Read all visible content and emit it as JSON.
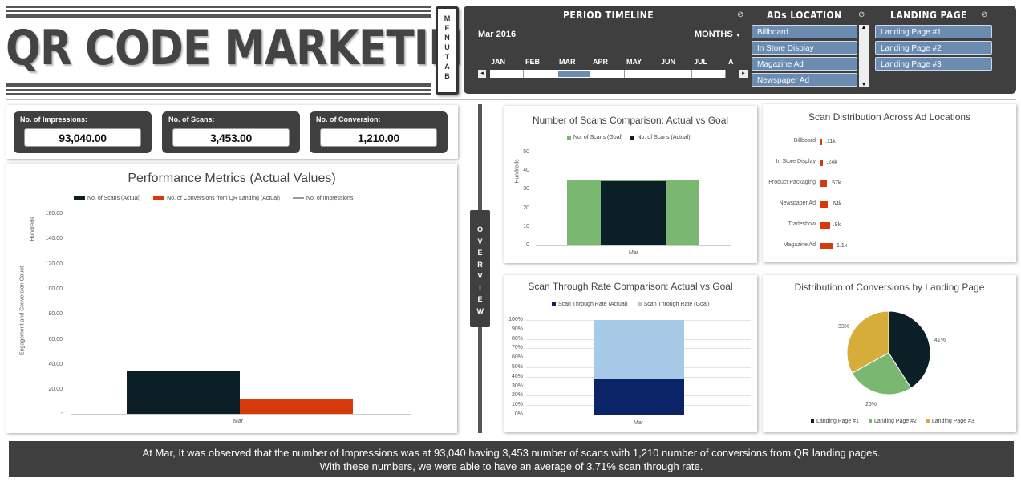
{
  "header": {
    "title": "QR CODE MARKETING",
    "menu_tab": "MENU TAB"
  },
  "timeline": {
    "title": "PERIOD TIMELINE",
    "selected_period": "Mar 2016",
    "granularity": "MONTHS",
    "months": [
      "JAN",
      "FEB",
      "MAR",
      "APR",
      "MAY",
      "JUN",
      "JUL",
      "A"
    ],
    "selected_month": "MAR"
  },
  "ad_locations": {
    "title": "ADs LOCATION",
    "items": [
      "Billboard",
      "In Store Display",
      "Magazine Ad",
      "Newspaper Ad"
    ]
  },
  "landing_pages": {
    "title": "LANDING PAGE",
    "items": [
      "Landing Page #1",
      "Landing Page #2",
      "Landing Page #3"
    ]
  },
  "kpis": [
    {
      "label": "No. of Impressions:",
      "value": "93,040.00"
    },
    {
      "label": "No. of Scans:",
      "value": "3,453.00"
    },
    {
      "label": "No. of Conversion:",
      "value": "1,210.00"
    }
  ],
  "overview_tab": "OVERVIEW",
  "colors": {
    "dark": "#3f3f3f",
    "navy": "#0b1f26",
    "orange": "#d63a0a",
    "green": "#7ab872",
    "slicer": "#6b8cb0",
    "gold": "#d6ac3a",
    "darkblue": "#0b2468",
    "lightblue": "#a6c9e8"
  },
  "summary": {
    "line1": "At Mar, It was observed that the number of Impressions was at 93,040 having 3,453 number of scans with 1,210 number of conversions from QR landing pages.",
    "line2": "With these numbers, we were able to have an average of 3.71% scan through rate."
  },
  "chart_data": [
    {
      "type": "bar",
      "title": "Performance Metrics (Actual Values)",
      "ylabel": "Engagement and Conversion Count",
      "units_label": "Hundreds",
      "categories": [
        "Mar"
      ],
      "yticks": [
        "160.00",
        "140.00",
        "120.00",
        "100.00",
        "80.00",
        "60.00",
        "40.00",
        "20.00",
        "-"
      ],
      "ylim": [
        0,
        160
      ],
      "series": [
        {
          "name": "No. of Scans (Actual)",
          "values": [
            34.53
          ]
        },
        {
          "name": "No. of Conversions from QR Landing (Actual)",
          "values": [
            12.1
          ]
        },
        {
          "name": "No. of Impressions",
          "values": [
            930.4
          ]
        }
      ]
    },
    {
      "type": "bar",
      "title": "Number of Scans Comparison: Actual vs Goal",
      "units_label": "Hundreds",
      "categories": [
        "Mar"
      ],
      "yticks": [
        "50",
        "40",
        "30",
        "20",
        "10",
        "0"
      ],
      "ylim": [
        0,
        50
      ],
      "series": [
        {
          "name": "No. of Scans (Goal)",
          "values": [
            35
          ]
        },
        {
          "name": "No. of Scans (Actual)",
          "values": [
            34.53
          ]
        }
      ]
    },
    {
      "type": "bar",
      "title": "Scan Distribution Across Ad Locations",
      "categories": [
        "Billboard",
        "In Store Display",
        "Product Packaging",
        "Newspaper Ad",
        "Tradeshow",
        "Magazine Ad"
      ],
      "values": [
        110,
        240,
        570,
        640,
        800,
        1100
      ],
      "labels": [
        ".11k",
        ".24k",
        ".57k",
        ".64k",
        ".8k",
        "1.1k"
      ]
    },
    {
      "type": "bar",
      "title": "Scan Through Rate Comparison: Actual vs Goal",
      "categories": [
        "Mar"
      ],
      "yticks": [
        "100%",
        "90%",
        "80%",
        "70%",
        "60%",
        "50%",
        "40%",
        "30%",
        "20%",
        "10%",
        "0%"
      ],
      "series": [
        {
          "name": "Scan Through Rate (Actual)",
          "values": [
            38
          ]
        },
        {
          "name": "Scan Through Rate (Goal)",
          "values": [
            62
          ]
        }
      ]
    },
    {
      "type": "pie",
      "title": "Distribution of Conversions by Landing Page",
      "categories": [
        "Landing Page #1",
        "Landing Page #2",
        "Landing Page #3"
      ],
      "values": [
        41,
        26,
        33
      ],
      "labels": [
        "41%",
        "26%",
        "33%"
      ]
    }
  ]
}
